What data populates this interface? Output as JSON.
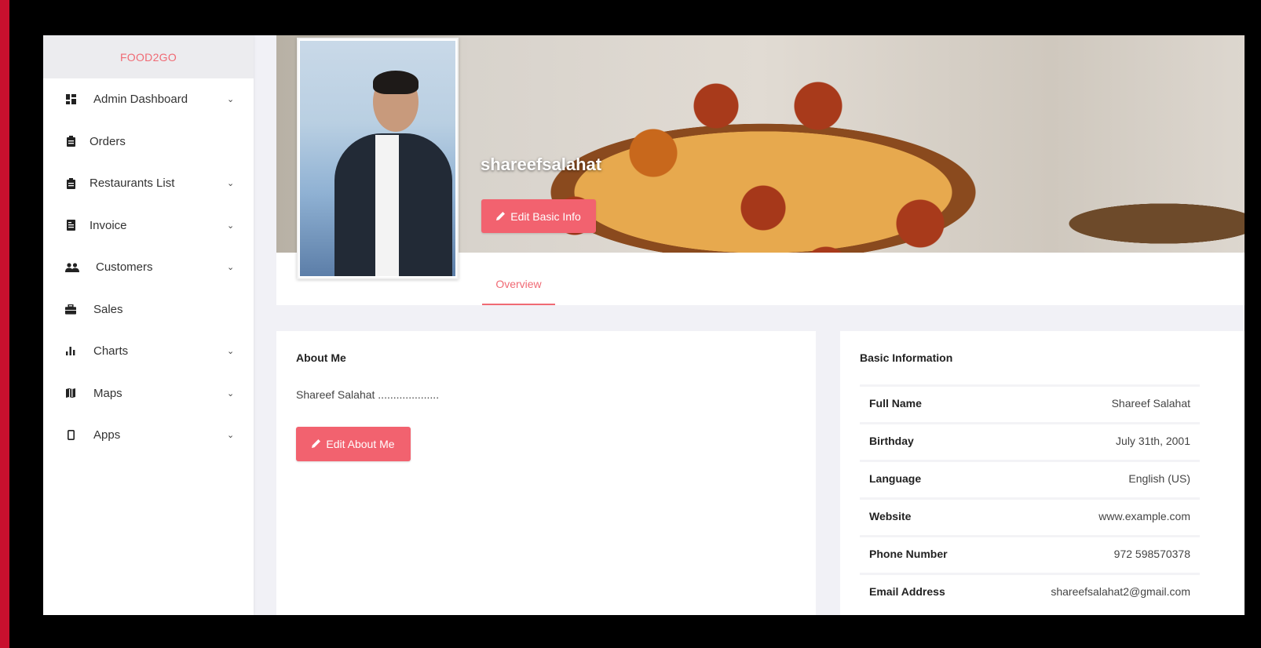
{
  "brand": "FOOD2GO",
  "sidebar": {
    "items": [
      {
        "label": "Admin Dashboard",
        "icon": "dashboard-icon",
        "chevron": true
      },
      {
        "label": "Orders",
        "icon": "clipboard-icon",
        "chevron": false
      },
      {
        "label": "Restaurants List",
        "icon": "clipboard-icon",
        "chevron": true
      },
      {
        "label": "Invoice",
        "icon": "invoice-icon",
        "chevron": true
      },
      {
        "label": "Customers",
        "icon": "users-icon",
        "chevron": true
      },
      {
        "label": "Sales",
        "icon": "briefcase-icon",
        "chevron": false
      },
      {
        "label": "Charts",
        "icon": "bar-chart-icon",
        "chevron": true
      },
      {
        "label": "Maps",
        "icon": "map-icon",
        "chevron": true
      },
      {
        "label": "Apps",
        "icon": "mobile-icon",
        "chevron": true
      }
    ]
  },
  "profile": {
    "username": "shareefsalahat",
    "edit_basic_label": "Edit Basic Info",
    "tab_overview": "Overview"
  },
  "about": {
    "title": "About Me",
    "text": "Shareef Salahat ....................",
    "edit_label": "Edit About Me"
  },
  "basic_info": {
    "title": "Basic Information",
    "rows": [
      {
        "label": "Full Name",
        "value": "Shareef Salahat"
      },
      {
        "label": "Birthday",
        "value": "July 31th, 2001"
      },
      {
        "label": "Language",
        "value": "English (US)"
      },
      {
        "label": "Website",
        "value": "www.example.com"
      },
      {
        "label": "Phone Number",
        "value": "972 598570378"
      },
      {
        "label": "Email Address",
        "value": "shareefsalahat2@gmail.com"
      }
    ]
  },
  "colors": {
    "accent": "#f2626f",
    "frame_border": "#c8102e",
    "background": "#000000"
  }
}
